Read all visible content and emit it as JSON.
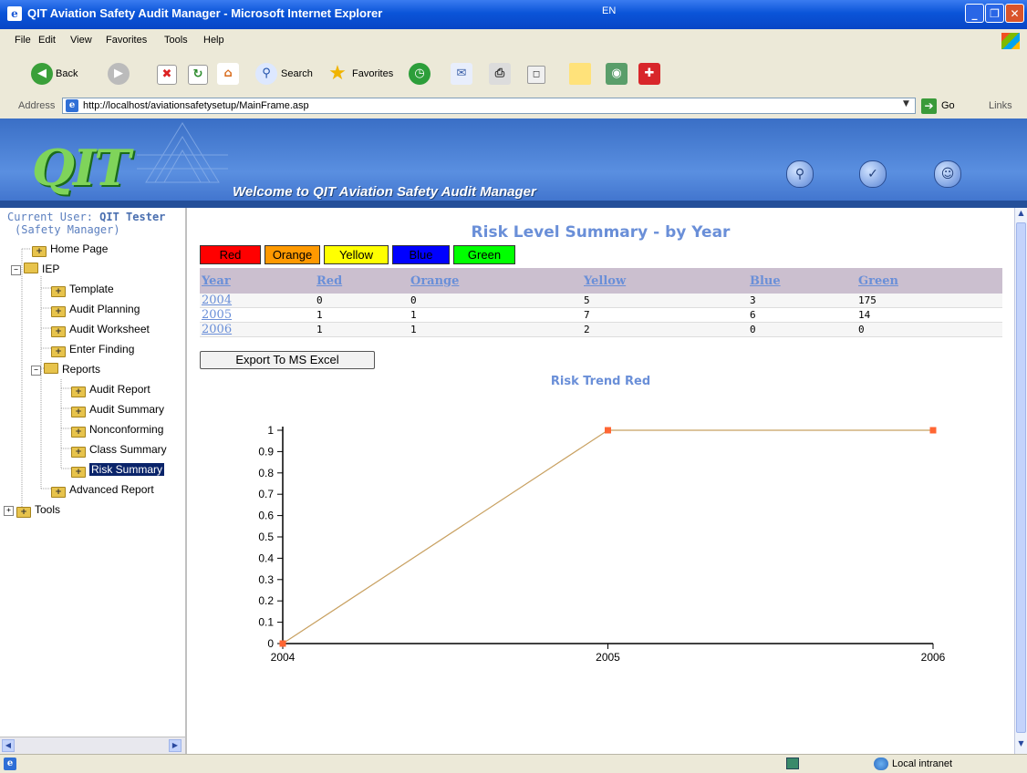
{
  "window": {
    "title": "QIT Aviation Safety Audit Manager - Microsoft Internet Explorer",
    "language": "EN"
  },
  "menu": [
    "File",
    "Edit",
    "View",
    "Favorites",
    "Tools",
    "Help"
  ],
  "toolbar": {
    "back": "Back",
    "search": "Search",
    "favorites": "Favorites"
  },
  "address": {
    "label": "Address",
    "url": "http://localhost/aviationsafetysetup/MainFrame.asp",
    "go": "Go",
    "links": "Links"
  },
  "banner": {
    "logo": "QIT",
    "welcome": "Welcome to QIT Aviation Safety Audit Manager"
  },
  "sidebar": {
    "user_label": "Current User:",
    "user_name": "QIT Tester",
    "user_role": "(Safety Manager)",
    "items": [
      "Home Page",
      "IEP",
      "Template",
      "Audit Planning",
      "Audit Worksheet",
      "Enter Finding",
      "Reports",
      "Audit Report",
      "Audit Summary",
      "Nonconforming",
      "Class Summary",
      "Risk Summary",
      "Advanced Report",
      "Tools"
    ]
  },
  "main": {
    "title": "Risk Level Summary - by Year",
    "legend": [
      {
        "label": "Red",
        "color": "#ff0000"
      },
      {
        "label": "Orange",
        "color": "#ff9900"
      },
      {
        "label": "Yellow",
        "color": "#ffff00"
      },
      {
        "label": "Blue",
        "color": "#0000ff"
      },
      {
        "label": "Green",
        "color": "#00ff00"
      }
    ],
    "table": {
      "headers": [
        "Year",
        "Red",
        "Orange",
        "Yellow",
        "Blue",
        "Green"
      ],
      "rows": [
        [
          "2004",
          "0",
          "0",
          "5",
          "3",
          "175"
        ],
        [
          "2005",
          "1",
          "1",
          "7",
          "6",
          "14"
        ],
        [
          "2006",
          "1",
          "1",
          "2",
          "0",
          "0"
        ]
      ]
    },
    "export_label": "Export To MS Excel",
    "chart_title": "Risk Trend Red"
  },
  "chart_data": {
    "type": "line",
    "title": "Risk Trend Red",
    "x": [
      "2004",
      "2005",
      "2006"
    ],
    "values": [
      0,
      1,
      1
    ],
    "ylim": [
      0,
      1
    ],
    "yticks": [
      "0",
      "0.1",
      "0.2",
      "0.3",
      "0.4",
      "0.5",
      "0.6",
      "0.7",
      "0.8",
      "0.9",
      "1"
    ],
    "line_color": "#c8a060",
    "marker_color": "#ff6633"
  },
  "status": {
    "zone": "Local intranet"
  }
}
